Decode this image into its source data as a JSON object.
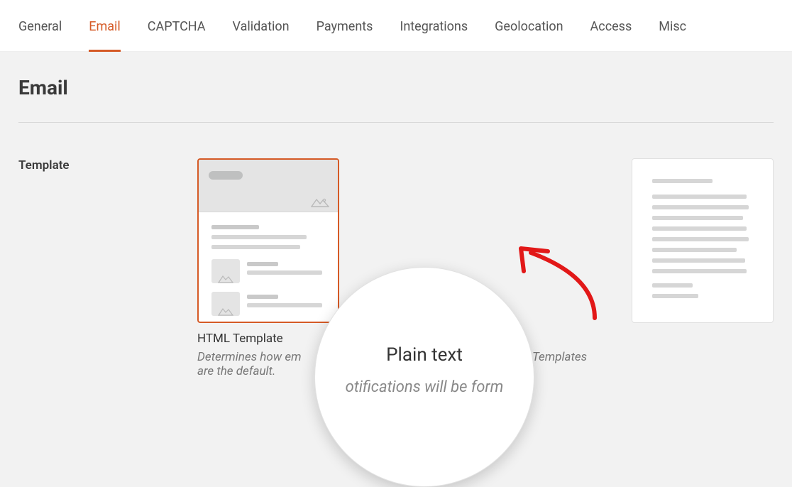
{
  "tabs": [
    {
      "label": "General",
      "active": false
    },
    {
      "label": "Email",
      "active": true
    },
    {
      "label": "CAPTCHA",
      "active": false
    },
    {
      "label": "Validation",
      "active": false
    },
    {
      "label": "Payments",
      "active": false
    },
    {
      "label": "Integrations",
      "active": false
    },
    {
      "label": "Geolocation",
      "active": false
    },
    {
      "label": "Access",
      "active": false
    },
    {
      "label": "Misc",
      "active": false
    }
  ],
  "page_title": "Email",
  "template": {
    "label": "Template",
    "options": {
      "html": {
        "label": "HTML Template",
        "selected": true
      },
      "plain": {
        "label": "Plain text",
        "selected": false
      }
    },
    "description_left": "Determines how em",
    "description_right": "ML Templates are the default.",
    "magnified_sub": "otifications will be form"
  },
  "colors": {
    "accent": "#d55a26",
    "annotation": "#e21818"
  }
}
